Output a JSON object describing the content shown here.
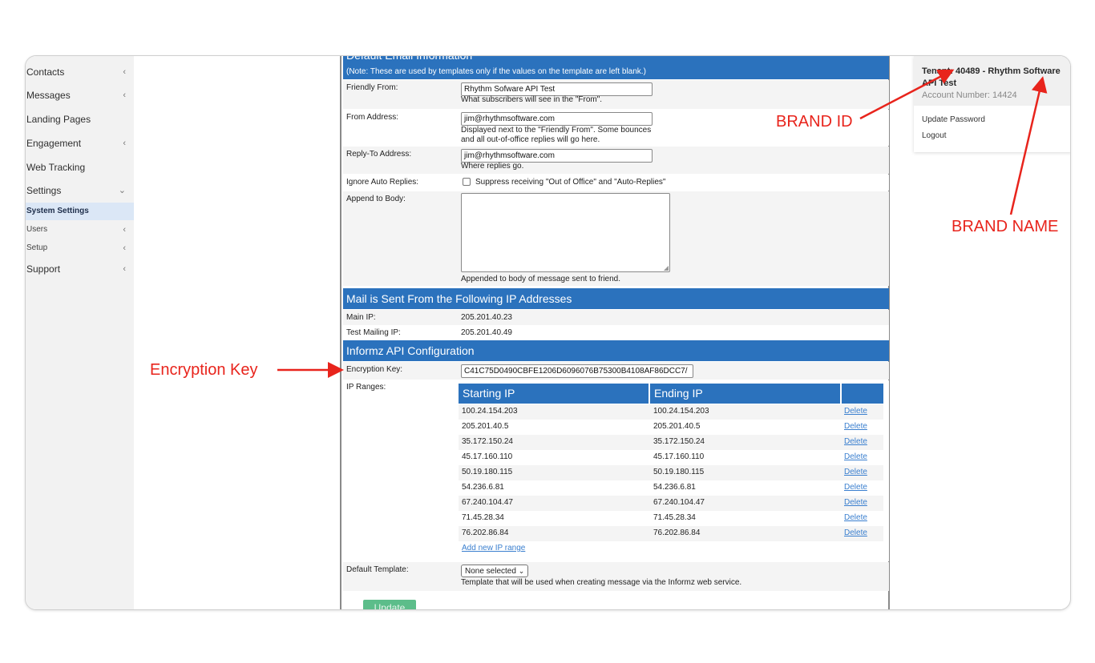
{
  "sidebar": {
    "items": [
      {
        "label": "Contacts",
        "chevron": "‹"
      },
      {
        "label": "Messages",
        "chevron": "‹"
      },
      {
        "label": "Landing Pages",
        "chevron": ""
      },
      {
        "label": "Engagement",
        "chevron": "‹"
      },
      {
        "label": "Web Tracking",
        "chevron": ""
      },
      {
        "label": "Settings",
        "chevron": "⌄"
      },
      {
        "label": "System Settings",
        "chevron": ""
      },
      {
        "label": "Users",
        "chevron": "‹"
      },
      {
        "label": "Setup",
        "chevron": "‹"
      },
      {
        "label": "Support",
        "chevron": "‹"
      }
    ]
  },
  "email_section": {
    "title": "Default Email Information",
    "note": "(Note: These are used by templates only if the values on the template are left blank.)",
    "friendly_from": {
      "label": "Friendly From:",
      "value": "Rhythm Sofware API Test",
      "hint": "What subscribers will see in the \"From\"."
    },
    "from_address": {
      "label": "From Address:",
      "value": "jim@rhythmsoftware.com",
      "hint1": "Displayed next to the \"Friendly From\". Some bounces",
      "hint2": "and all out-of-office replies will go here."
    },
    "reply_to": {
      "label": "Reply-To Address:",
      "value": "jim@rhythmsoftware.com",
      "hint": "Where replies go."
    },
    "ignore_auto": {
      "label": "Ignore Auto Replies:",
      "checkbox_label": "Suppress receiving \"Out of Office\" and \"Auto-Replies\""
    },
    "append_body": {
      "label": "Append to Body:",
      "hint": "Appended to body of message sent to friend."
    }
  },
  "ip_section": {
    "title": "Mail is Sent From the Following IP Addresses",
    "main_ip": {
      "label": "Main IP:",
      "value": "205.201.40.23"
    },
    "test_ip": {
      "label": "Test Mailing IP:",
      "value": "205.201.40.49"
    }
  },
  "api_section": {
    "title": "Informz API Configuration",
    "encryption_key": {
      "label": "Encryption Key:",
      "value": "C41C75D0490CBFE1206D6096076B75300B4108AF86DCC7/"
    },
    "ip_ranges_label": "IP Ranges:",
    "table_headers": {
      "start": "Starting IP",
      "end": "Ending IP"
    },
    "ranges": [
      {
        "start": "100.24.154.203",
        "end": "100.24.154.203",
        "action": "Delete"
      },
      {
        "start": "205.201.40.5",
        "end": "205.201.40.5",
        "action": "Delete"
      },
      {
        "start": "35.172.150.24",
        "end": "35.172.150.24",
        "action": "Delete"
      },
      {
        "start": "45.17.160.110",
        "end": "45.17.160.110",
        "action": "Delete"
      },
      {
        "start": "50.19.180.115",
        "end": "50.19.180.115",
        "action": "Delete"
      },
      {
        "start": "54.236.6.81",
        "end": "54.236.6.81",
        "action": "Delete"
      },
      {
        "start": "67.240.104.47",
        "end": "67.240.104.47",
        "action": "Delete"
      },
      {
        "start": "71.45.28.34",
        "end": "71.45.28.34",
        "action": "Delete"
      },
      {
        "start": "76.202.86.84",
        "end": "76.202.86.84",
        "action": "Delete"
      }
    ],
    "add_range": "Add new IP range",
    "default_template": {
      "label": "Default Template:",
      "value": "None selected",
      "hint": "Template that will be used when creating message via the Informz web service."
    },
    "update_label": "Update"
  },
  "user_panel": {
    "tenant_line1": "Tenant: 40489 - Rhythm Software",
    "tenant_line2": "API Test",
    "account": "Account Number: 14424",
    "update_password": "Update Password",
    "logout": "Logout"
  },
  "annotations": {
    "brand_id": "BRAND ID",
    "brand_name": "BRAND NAME",
    "encryption_key": "Encryption Key",
    "color": "#e8241c"
  }
}
